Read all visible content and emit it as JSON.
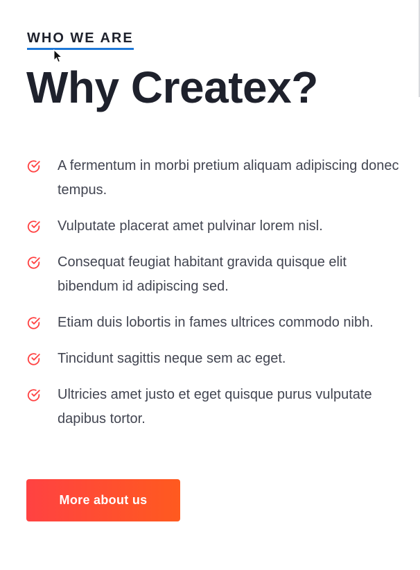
{
  "section": {
    "eyebrow": "WHO WE ARE",
    "title": "Why Createx?"
  },
  "features": [
    "A fermentum in morbi pretium aliquam adipiscing donec tempus.",
    "Vulputate placerat amet pulvinar lorem nisl.",
    "Consequat feugiat habitant gravida quisque elit bibendum id adipiscing sed.",
    "Etiam duis lobortis in fames ultrices commodo nibh.",
    "Tincidunt sagittis neque sem ac eget.",
    "Ultricies amet justo et eget quisque purus vulputate dapibus tortor."
  ],
  "icons": {
    "check": "check-circle-icon",
    "cursor": "mouse-pointer-icon"
  },
  "cta": {
    "label": "More about us"
  },
  "colors": {
    "heading": "#1e212c",
    "body_text": "#424551",
    "eyebrow_underline": "#1e78d7",
    "check_icon": "#ff4242",
    "cta_gradient_start": "#ff4242",
    "cta_gradient_end": "#ff5a1f",
    "cta_text": "#ffffff"
  }
}
